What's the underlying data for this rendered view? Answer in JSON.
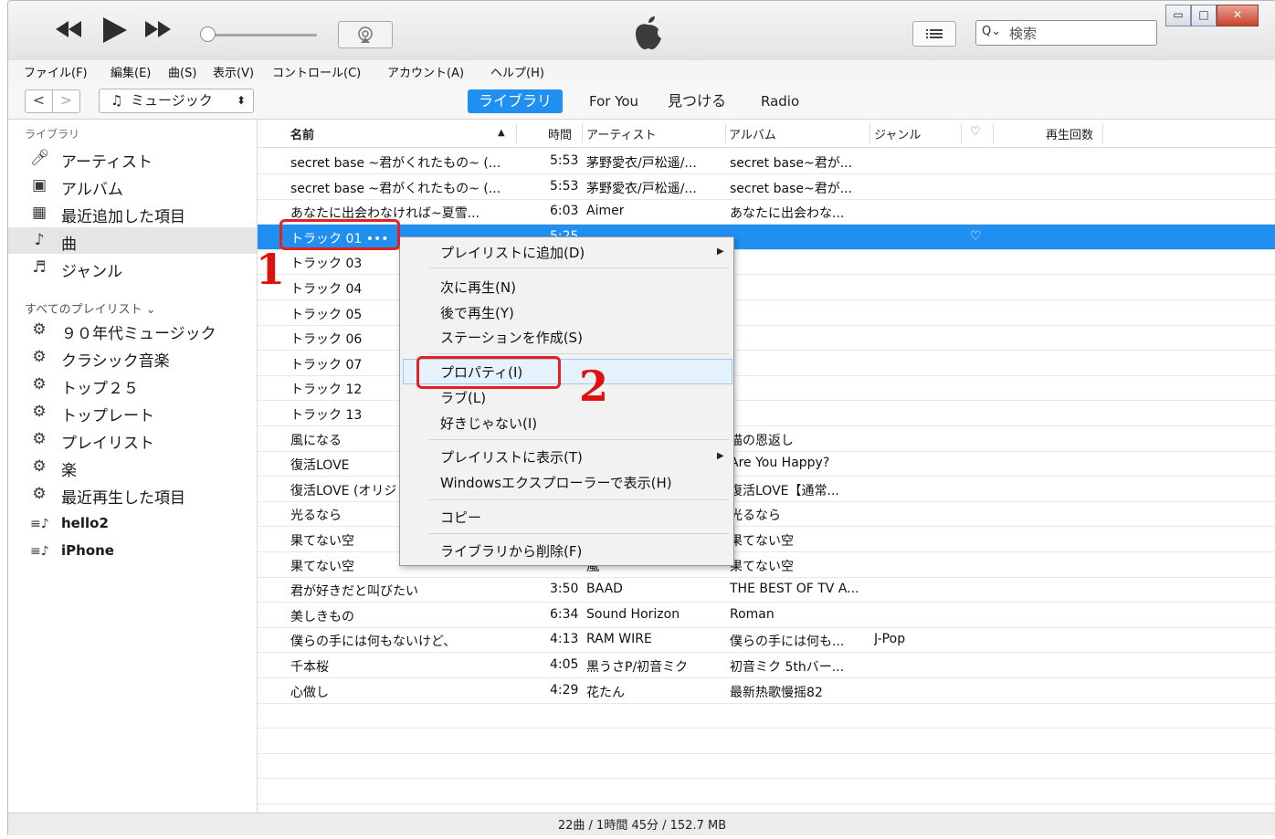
{
  "player": {
    "search_placeholder": "検索",
    "accent_color": "#1f8ff2",
    "icons": [
      "rewind-icon",
      "play-icon",
      "fast-forward-icon",
      "airplay-icon",
      "apple-logo",
      "list-icon",
      "search-icon"
    ]
  },
  "menubar": [
    "ファイル(F)",
    "編集(E)",
    "曲(S)",
    "表示(V)",
    "コントロール(C)",
    "アカウント(A)",
    "ヘルプ(H)"
  ],
  "nav": {
    "back": "<",
    "forward": ">",
    "media_kind": "ミュージック",
    "tabs": [
      "ライブラリ",
      "For You",
      "見つける",
      "Radio"
    ]
  },
  "sidebar": {
    "library_header": "ライブラリ",
    "library_items": [
      {
        "icon": "artist-icon",
        "label": "アーティスト"
      },
      {
        "icon": "album-icon",
        "label": "アルバム"
      },
      {
        "icon": "recently-added-icon",
        "label": "最近追加した項目"
      },
      {
        "icon": "song-icon",
        "label": "曲"
      },
      {
        "icon": "genre-icon",
        "label": "ジャンル"
      }
    ],
    "playlists_header": "すべてのプレイリスト ⌄",
    "playlists": [
      {
        "icon": "gear-icon",
        "label": "９０年代ミュージック"
      },
      {
        "icon": "gear-icon",
        "label": "クラシック音楽"
      },
      {
        "icon": "gear-icon",
        "label": "トップ２５"
      },
      {
        "icon": "gear-icon",
        "label": "トップレート"
      },
      {
        "icon": "gear-icon",
        "label": "プレイリスト"
      },
      {
        "icon": "gear-icon",
        "label": "楽"
      },
      {
        "icon": "gear-icon",
        "label": "最近再生した項目"
      },
      {
        "icon": "playlist-icon",
        "label": "hello2"
      },
      {
        "icon": "playlist-icon",
        "label": "iPhone"
      }
    ]
  },
  "columns": {
    "name": "名前",
    "time": "時間",
    "artist": "アーティスト",
    "album": "アルバム",
    "genre": "ジャンル",
    "love": "♡",
    "plays": "再生回数"
  },
  "tracks": [
    {
      "name": "secret base ~君がくれたもの~ (...",
      "time": "5:53",
      "artist": "茅野愛衣/戸松遥/...",
      "album": "secret base~君が...",
      "genre": ""
    },
    {
      "name": "secret base ~君がくれたもの~ (...",
      "time": "5:53",
      "artist": "茅野愛衣/戸松遥/...",
      "album": "secret base~君が...",
      "genre": ""
    },
    {
      "name": "あなたに出会わなければ~夏雪...",
      "time": "6:03",
      "artist": "Aimer",
      "album": "あなたに出会わな...",
      "genre": ""
    },
    {
      "name": "トラック 01 •••",
      "time": "5:25",
      "artist": "",
      "album": "",
      "genre": "",
      "love": "♡"
    },
    {
      "name": "トラック 03",
      "time": "",
      "artist": "",
      "album": "",
      "genre": ""
    },
    {
      "name": "トラック 04",
      "time": "",
      "artist": "",
      "album": "",
      "genre": ""
    },
    {
      "name": "トラック 05",
      "time": "",
      "artist": "",
      "album": "",
      "genre": ""
    },
    {
      "name": "トラック 06",
      "time": "",
      "artist": "",
      "album": "",
      "genre": ""
    },
    {
      "name": "トラック 07",
      "time": "",
      "artist": "",
      "album": "",
      "genre": ""
    },
    {
      "name": "トラック 12",
      "time": "",
      "artist": "",
      "album": "",
      "genre": ""
    },
    {
      "name": "トラック 13",
      "time": "",
      "artist": "",
      "album": "",
      "genre": ""
    },
    {
      "name": "風になる",
      "time": "",
      "artist": "",
      "album": "猫の恩返し",
      "genre": ""
    },
    {
      "name": "復活LOVE",
      "time": "",
      "artist": "",
      "album": "Are You Happy?",
      "genre": ""
    },
    {
      "name": "復活LOVE (オリジ",
      "time": "",
      "artist": "",
      "album": "復活LOVE【通常...",
      "genre": ""
    },
    {
      "name": "光るなら",
      "time": "",
      "artist": "",
      "album": "光るなら",
      "genre": ""
    },
    {
      "name": "果てない空",
      "time": "",
      "artist": "",
      "album": "果てない空",
      "genre": ""
    },
    {
      "name": "果てない空",
      "time": "",
      "artist": "嵐",
      "album": "果てない空",
      "genre": ""
    },
    {
      "name": "君が好きだと叫びたい",
      "time": "3:50",
      "artist": "BAAD",
      "album": "THE BEST OF TV A...",
      "genre": ""
    },
    {
      "name": "美しきもの",
      "time": "6:34",
      "artist": "Sound Horizon",
      "album": "Roman",
      "genre": ""
    },
    {
      "name": "僕らの手には何もないけど、",
      "time": "4:13",
      "artist": "RAM WIRE",
      "album": "僕らの手には何も...",
      "genre": "J-Pop"
    },
    {
      "name": "千本桜",
      "time": "4:05",
      "artist": "黒うさP/初音ミク",
      "album": "初音ミク 5thバー...",
      "genre": ""
    },
    {
      "name": "心做し",
      "time": "4:29",
      "artist": "花たん",
      "album": "最新热歌慢摇82",
      "genre": ""
    }
  ],
  "context_menu": [
    {
      "label": "プレイリストに追加(D)",
      "submenu": "▶"
    },
    {
      "label": "次に再生(N)"
    },
    {
      "label": "後で再生(Y)"
    },
    {
      "label": "ステーションを作成(S)"
    },
    {
      "label": "プロパティ(I)"
    },
    {
      "label": "ラブ(L)"
    },
    {
      "label": "好きじゃない(I)"
    },
    {
      "label": "プレイリストに表示(T)",
      "submenu": "▶"
    },
    {
      "label": "Windowsエクスプローラーで表示(H)"
    },
    {
      "label": "コピー"
    },
    {
      "label": "ライブラリから削除(F)"
    }
  ],
  "annotations": {
    "step1": "1",
    "step2": "2",
    "highlight_color": "#e52020"
  },
  "status": "22曲 / 1時間 45分 / 152.7 MB"
}
